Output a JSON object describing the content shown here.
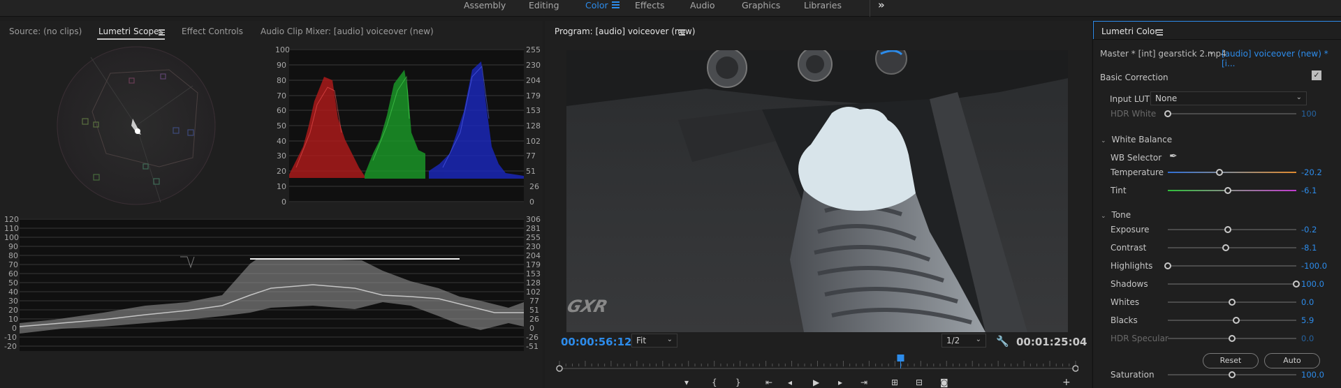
{
  "workspaces": {
    "items": [
      "Assembly",
      "Editing",
      "Color",
      "Effects",
      "Audio",
      "Graphics",
      "Libraries"
    ],
    "active": "Color",
    "more": "»"
  },
  "source_panel": {
    "tabs": [
      "Source: (no clips)",
      "Lumetri Scopes",
      "Effect Controls",
      "Audio Clip Mixer: [audio] voiceover (new)"
    ],
    "active_tab": "Lumetri Scopes"
  },
  "rgb_parade": {
    "left_ticks": [
      "100",
      "90",
      "80",
      "70",
      "60",
      "50",
      "40",
      "30",
      "20",
      "10",
      "0"
    ],
    "right_ticks": [
      "255",
      "230",
      "204",
      "179",
      "153",
      "128",
      "102",
      "77",
      "51",
      "26",
      "0"
    ]
  },
  "waveform": {
    "left_ticks": [
      "120",
      "110",
      "100",
      "90",
      "80",
      "70",
      "60",
      "50",
      "40",
      "30",
      "20",
      "10",
      "0",
      "-10",
      "-20"
    ],
    "right_ticks": [
      "306",
      "281",
      "255",
      "230",
      "204",
      "179",
      "153",
      "128",
      "102",
      "77",
      "51",
      "26",
      "0",
      "-26",
      "-51"
    ]
  },
  "program": {
    "title": "Program: [audio] voiceover (new)",
    "current_timecode": "00:00:56:12",
    "fit": "Fit",
    "resolution": "1/2",
    "duration": "00:01:25:04",
    "overlay_logo_text": "GXR",
    "playhead_position": 0.661
  },
  "lumetri": {
    "title": "Lumetri Color",
    "master_clip": "Master * [int] gearstick 2.mp4",
    "sequence_clip": "[audio] voiceover (new) * [i...",
    "basic_correction": "Basic Correction",
    "basic_correction_enabled": true,
    "input_lut_label": "Input LUT",
    "input_lut_value": "None",
    "hdr_white": {
      "label": "HDR White",
      "value": "100",
      "position": 0.0
    },
    "white_balance": "White Balance",
    "wb_selector": "WB Selector",
    "temperature": {
      "label": "Temperature",
      "value": "-20.2",
      "position": 0.4
    },
    "tint": {
      "label": "Tint",
      "value": "-6.1",
      "position": 0.47
    },
    "tone": "Tone",
    "exposure": {
      "label": "Exposure",
      "value": "-0.2",
      "position": 0.47
    },
    "contrast": {
      "label": "Contrast",
      "value": "-8.1",
      "position": 0.45
    },
    "highlights": {
      "label": "Highlights",
      "value": "-100.0",
      "position": 0.0
    },
    "shadows": {
      "label": "Shadows",
      "value": "100.0",
      "position": 1.0
    },
    "whites": {
      "label": "Whites",
      "value": "0.0",
      "position": 0.5
    },
    "blacks": {
      "label": "Blacks",
      "value": "5.9",
      "position": 0.53
    },
    "hdr_specular": {
      "label": "HDR Specular",
      "value": "0.0",
      "position": 0.5
    },
    "reset": "Reset",
    "auto": "Auto",
    "saturation": {
      "label": "Saturation",
      "value": "100.0",
      "position": 0.5
    }
  }
}
